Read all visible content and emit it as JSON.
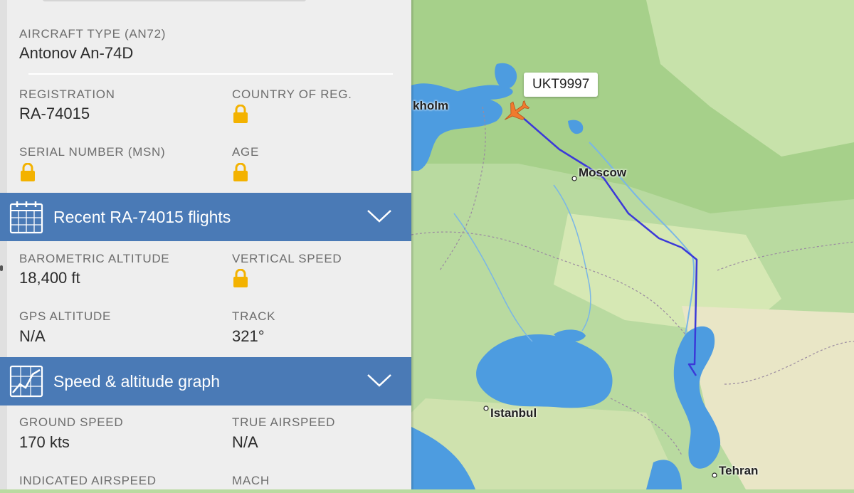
{
  "panel": {
    "aircraft_type_label": "AIRCRAFT TYPE (AN72)",
    "aircraft_type_value": "Antonov An-74D",
    "registration_label": "REGISTRATION",
    "registration_value": "RA-74015",
    "country_label": "COUNTRY OF REG.",
    "serial_label": "SERIAL NUMBER (MSN)",
    "age_label": "AGE",
    "recent_flights_title": "Recent RA-74015 flights",
    "baro_alt_label": "BAROMETRIC ALTITUDE",
    "baro_alt_value": "18,400 ft",
    "vert_speed_label": "VERTICAL SPEED",
    "gps_alt_label": "GPS ALTITUDE",
    "gps_alt_value": "N/A",
    "track_label": "TRACK",
    "track_value": "321°",
    "graph_title": "Speed & altitude graph",
    "ground_speed_label": "GROUND SPEED",
    "ground_speed_value": "170 kts",
    "true_airspeed_label": "TRUE AIRSPEED",
    "true_airspeed_value": "N/A",
    "indicated_airspeed_label": "INDICATED AIRSPEED",
    "mach_label": "MACH"
  },
  "map": {
    "callsign": "UKT9997",
    "cities": {
      "stockholm": "kholm",
      "moscow": "Moscow",
      "istanbul": "Istanbul",
      "tehran": "Tehran"
    }
  },
  "colors": {
    "header_bar": "#4a7ab6",
    "lock": "#f3b200",
    "route": "#3b39d8",
    "plane": "#f07a2e",
    "water": "#4d9ce0",
    "land": "#b9daa0"
  },
  "icons": {
    "calendar": "calendar-icon",
    "graph": "graph-icon",
    "chevron": "chevron-down-icon",
    "lock": "lock-icon",
    "plane": "plane-icon"
  }
}
